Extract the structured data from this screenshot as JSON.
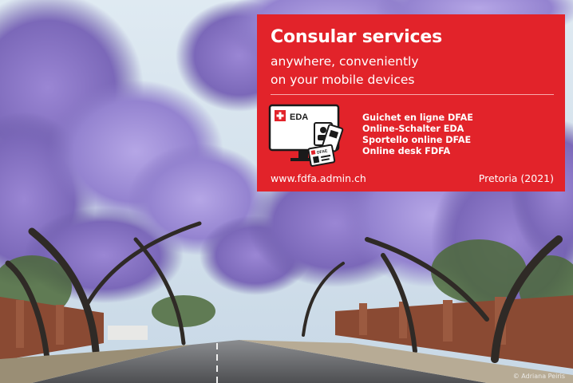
{
  "poster": {
    "title": "Consular services",
    "subtitle_lines": [
      "anywhere, conveniently",
      "on your mobile devices"
    ],
    "device_label": "EDA",
    "card_label": "DFAE",
    "online_desk_names": [
      "Guichet en ligne DFAE",
      "Online-Schalter EDA",
      "Sportello online DFAE",
      "Online desk FDFA"
    ],
    "website": "www.fdfa.admin.ch",
    "location_year": "Pretoria (2021)",
    "photo_credit": "© Adriana Peiris"
  },
  "colors": {
    "panel_red": "#e2232a",
    "jacaranda_purple": "#8d79c8",
    "sky": "#cfe0ec",
    "road": "#5e5f62"
  },
  "icons": [
    "swiss-cross-icon",
    "monitor-icon",
    "id-card-icon",
    "passport-icon"
  ]
}
